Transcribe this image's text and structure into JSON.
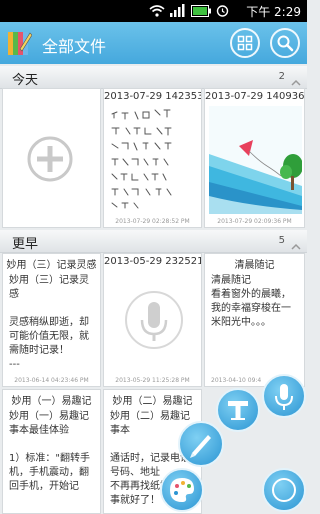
{
  "status": {
    "time": "下午 2:29"
  },
  "header": {
    "title": "全部文件"
  },
  "sections": {
    "today": {
      "label": "今天",
      "count": "2"
    },
    "earlier": {
      "label": "更早",
      "count": "5"
    }
  },
  "today_cards": [
    {
      "title": "2013-07-29 142353",
      "date": "2013-07-29 02:28:52 PM"
    },
    {
      "title": "2013-07-29 140936",
      "date": "2013-07-29 02:09:36 PM"
    }
  ],
  "earlier_cards": [
    {
      "title": "妙用（三）记录灵感",
      "body": "妙用（三）记录灵感\n\n灵感稍纵即逝，却可能价值无限，就需随时记录！\n---",
      "date": "2013-06-14 04:23:46 PM"
    },
    {
      "title": "2013-05-29 232521",
      "date": "2013-05-29 11:25:28 PM"
    },
    {
      "title": "清晨随记",
      "body": "清晨随记\n看着窗外的晨曦，我的幸福穿梭在一米阳光中。。。",
      "date": "2013-04-10 09:4"
    },
    {
      "title": "妙用（一）易趣记",
      "body": "妙用（一）易趣记事本最佳体验\n\n1）标准：\"翻转手机，手机震动，翻回手机，开始记"
    },
    {
      "title": "妙用（二）易趣记",
      "body": "妙用（二）易趣记事本\n\n通话时，记录电话号码、地址\n不再再找纸笔\n事就好了！"
    }
  ]
}
